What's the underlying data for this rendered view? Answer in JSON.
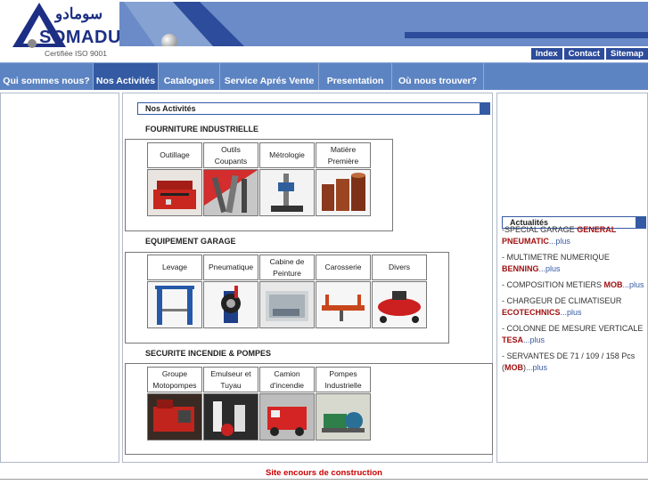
{
  "logo": {
    "arabic": "سومادو",
    "brand": "SOMADU",
    "cert": "Certifiée ISO 9001"
  },
  "toplinks": [
    "Index",
    "Contact",
    "Sitemap"
  ],
  "nav": [
    {
      "label": "Qui sommes nous?"
    },
    {
      "label": "Nos Activités"
    },
    {
      "label": "Catalogues"
    },
    {
      "label": "Service Aprés Vente"
    },
    {
      "label": "Presentation"
    },
    {
      "label": "Où nous trouver?"
    }
  ],
  "activities": {
    "heading": "Nos Activités",
    "categories": [
      {
        "title": "FOURNITURE INDUSTRIELLE",
        "items": [
          "Outillage",
          "Outils Coupants",
          "Métrologie",
          "Matière Première"
        ]
      },
      {
        "title": "EQUIPEMENT GARAGE",
        "items": [
          "Levage",
          "Pneumatique",
          "Cabine de Peinture",
          "Carosserie",
          "Divers"
        ]
      },
      {
        "title": "SECURITE INCENDIE & POMPES",
        "items": [
          "Groupe Motopompes",
          "Emulseur et Tuyau",
          "Camion d'incendie",
          "Pompes Industrielle"
        ]
      }
    ]
  },
  "news": {
    "heading": "Actualités",
    "items": [
      {
        "pre": "-SPECIAL GARAGE ",
        "brand": "GENERAL PNEUMATIC",
        "plus": "...plus"
      },
      {
        "pre": "- MULTIMETRE NUMERIQUE ",
        "brand": "BENNING",
        "plus": "...plus"
      },
      {
        "pre": "- COMPOSITION METIERS ",
        "brand": "MOB",
        "plus": "...plus"
      },
      {
        "pre": "- CHARGEUR DE CLIMATISEUR ",
        "brand": "ECOTECHNICS",
        "plus": "...plus"
      },
      {
        "pre": "- COLONNE DE MESURE VERTICALE ",
        "brand": "TESA",
        "plus": "...plus"
      },
      {
        "pre": "- SERVANTES DE 71 / 109 / 158 Pcs (",
        "brand": "MOB",
        "post": ")",
        "plus": "...plus"
      }
    ]
  },
  "footer": {
    "construction": "Site encours de construction"
  },
  "colors": {
    "navbar": "#5d84c2",
    "dark_blue": "#345aa3",
    "brand_red": "#a01010",
    "warning_red": "#cc0000"
  }
}
